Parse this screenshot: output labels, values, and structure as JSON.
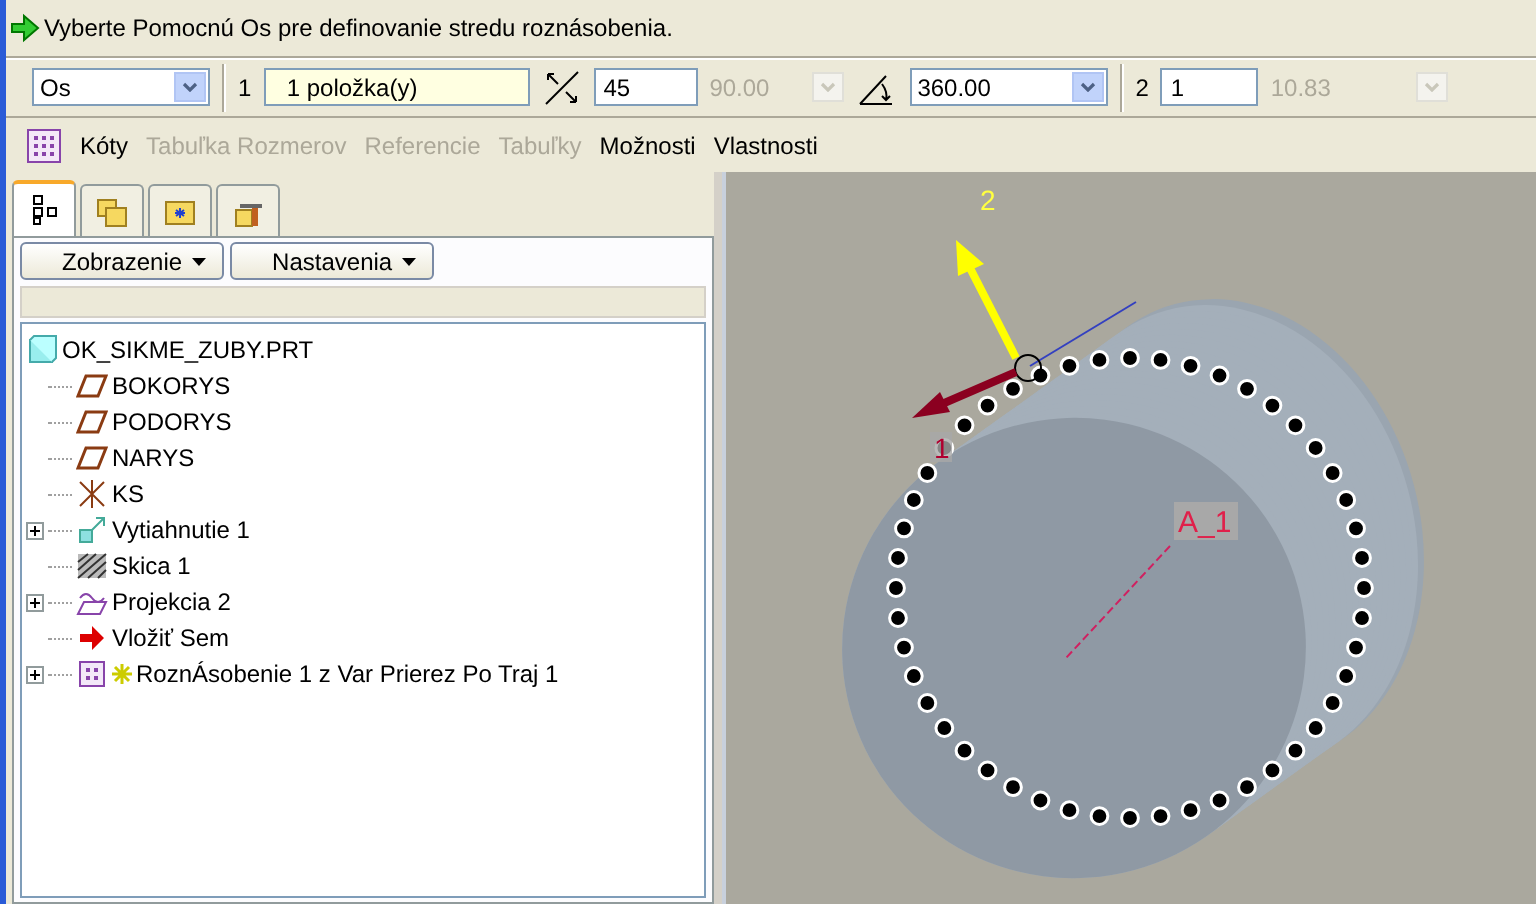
{
  "prompt": {
    "text": "Vyberte Pomocnú Os pre definovanie stredu roznásobenia."
  },
  "toolbar": {
    "type_select": "Os",
    "step1_label": "1",
    "selection_field": "1 položka(y)",
    "count_field": "45",
    "count_disabled": "90.00",
    "angle_select": "360.00",
    "step2_label": "2",
    "step2_field": "1",
    "step2_disabled": "10.83"
  },
  "links": [
    {
      "label": "Kóty",
      "disabled": false
    },
    {
      "label": "Tabuľka Rozmerov",
      "disabled": true
    },
    {
      "label": "Referencie",
      "disabled": true
    },
    {
      "label": "Tabuľky",
      "disabled": true
    },
    {
      "label": "Možnosti",
      "disabled": false
    },
    {
      "label": "Vlastnosti",
      "disabled": false
    }
  ],
  "panel_tabs": [
    {
      "kind": "tree",
      "selected": true
    },
    {
      "kind": "folders",
      "selected": false
    },
    {
      "kind": "star-folder",
      "selected": false
    },
    {
      "kind": "tools",
      "selected": false
    }
  ],
  "panel_buttons": [
    "Zobrazenie",
    "Nastavenia"
  ],
  "tree": {
    "label": "OK_SIKME_ZUBY.PRT",
    "children": [
      {
        "label": "BOKORYS",
        "kind": "plane",
        "collapsed": false
      },
      {
        "label": "PODORYS",
        "kind": "plane",
        "collapsed": false
      },
      {
        "label": "NARYS",
        "kind": "plane",
        "collapsed": false
      },
      {
        "label": "KS",
        "kind": "csys",
        "collapsed": false
      },
      {
        "label": "Vytiahnutie 1",
        "kind": "extrude",
        "collapsed": true
      },
      {
        "label": "Skica 1",
        "kind": "sketch",
        "collapsed": false
      },
      {
        "label": "Projekcia 2",
        "kind": "projection",
        "collapsed": true
      },
      {
        "label": "Vložiť Sem",
        "kind": "insert",
        "collapsed": false
      },
      {
        "label": "RoznÁsobenie 1 z Var Prierez Po Traj 1",
        "kind": "pattern",
        "collapsed": true
      }
    ]
  },
  "viewport": {
    "labels": [
      "2",
      "1",
      "A_1"
    ]
  }
}
